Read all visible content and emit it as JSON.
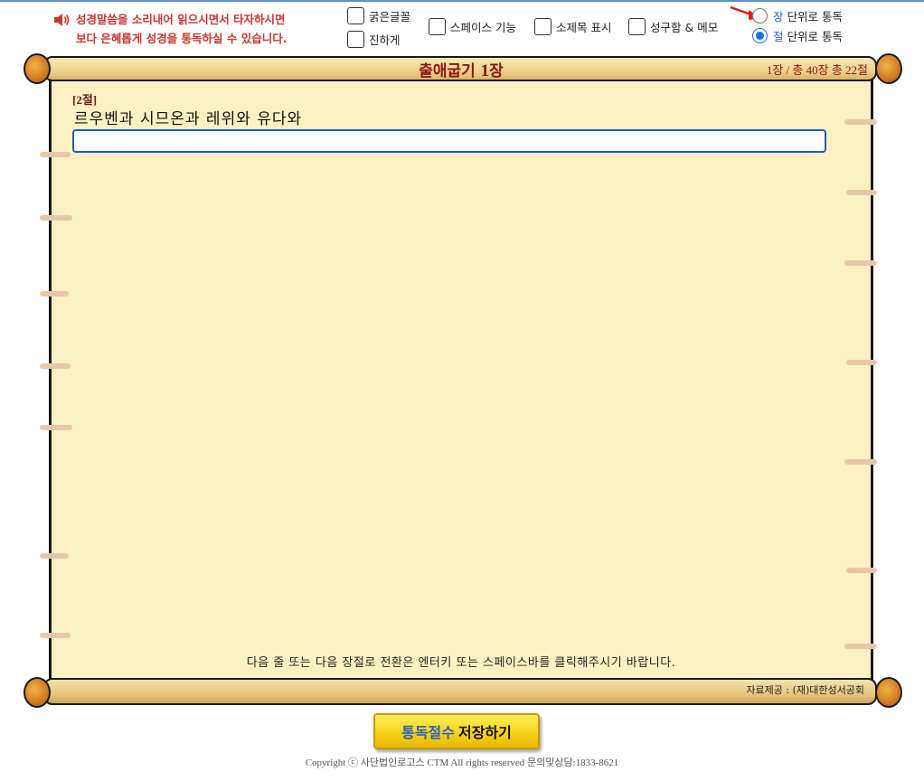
{
  "header": {
    "instruction_line1": "성경말씀을 소리내어 읽으시면서 타자하시면",
    "instruction_line2": "보다 은혜롭게 성경을 통독하실 수 있습니다."
  },
  "options": {
    "bold_font": "굵은글꼴",
    "darker": "진하게",
    "space_feature": "스페이스 기능",
    "subtitle_display": "소제목 표시",
    "verse_memo": "성구함 & 메모"
  },
  "read_mode": {
    "chapter_key": "장",
    "chapter_rest": " 단위로 통독",
    "verse_key": "절",
    "verse_rest": " 단위로 통독",
    "selected": "verse"
  },
  "title": {
    "book": "출애굽기",
    "chapter_num": "1",
    "chapter_suffix": "장"
  },
  "progress": "1장 / 총 40장   총 22절",
  "verse": {
    "number": "[2절]",
    "text": "르우벤과 시므온과 레위와 유다와"
  },
  "typing_input": {
    "value": "",
    "placeholder": ""
  },
  "hint": "다음 줄 또는 다음 장절로 전환은 엔터키 또는 스페이스바를 클릭해주시기 바랍니다.",
  "source": "자료제공 : (재)대한성서공회",
  "save_button": {
    "part1": "통독절수",
    "part2": "저장하기"
  },
  "copyright": "Copyright ⓒ 사단법인로고스 CTM All rights reserved 문의및상담:1833-8621",
  "colors": {
    "accent_red": "#c8372d",
    "title_red": "#8b1414",
    "input_blue": "#1f5fb8",
    "paper": "#fdf0c3",
    "button_yellow": "#f7d21a"
  },
  "icons": {
    "speaker": "speaker-icon",
    "arrow": "red-arrow-icon"
  }
}
